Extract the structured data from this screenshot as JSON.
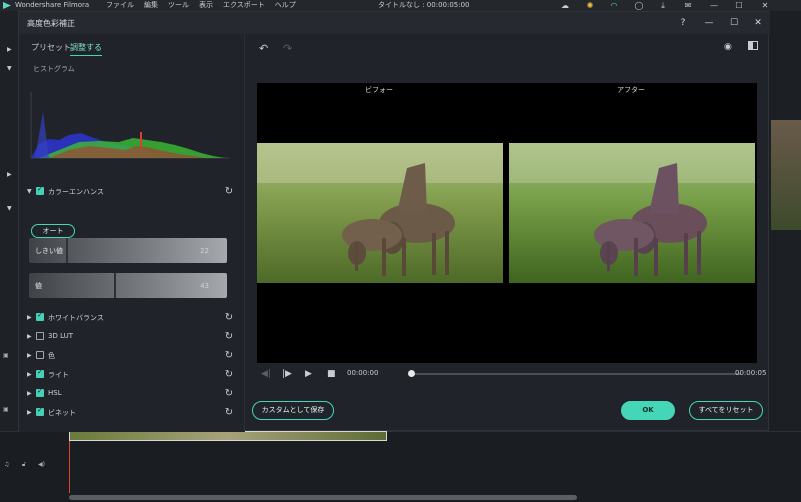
{
  "app": {
    "name": "Wondershare Filmora",
    "menus": [
      "ファイル",
      "編集",
      "ツール",
      "表示",
      "エクスポート",
      "ヘルプ"
    ],
    "document_title": "タイトルなし : 00:00:05:00"
  },
  "dialog": {
    "title": "高度色彩補正",
    "help_icon": "?",
    "minimize_icon": "—",
    "maximize_icon": "☐",
    "close_icon": "✕"
  },
  "tabs": {
    "preset": "プリセット",
    "adjust": "調整する"
  },
  "histogram": {
    "label": "ヒストグラム"
  },
  "color_enhance": {
    "label": "カラーエンハンス",
    "checked": true,
    "auto_button": "オート",
    "threshold": {
      "label": "しきい値",
      "value": "22",
      "fraction": 0.22
    },
    "amount": {
      "label": "値",
      "value": "43",
      "fraction": 0.43
    }
  },
  "sections": [
    {
      "label": "ホワイトバランス",
      "checked": true
    },
    {
      "label": "3D LUT",
      "checked": false
    },
    {
      "label": "色",
      "checked": false
    },
    {
      "label": "ライト",
      "checked": true
    },
    {
      "label": "HSL",
      "checked": true
    },
    {
      "label": "ビネット",
      "checked": true
    }
  ],
  "preview": {
    "before_label": "ビフォー",
    "after_label": "アフター"
  },
  "playback": {
    "current_time": "00:00:00",
    "end_time": "00:00:05",
    "progress": 0.0
  },
  "buttons": {
    "save_custom": "カスタムとして保存",
    "ok": "OK",
    "reset_all": "すべてをリセット"
  },
  "colors": {
    "accent": "#45d6b8",
    "background": "#20242a"
  }
}
